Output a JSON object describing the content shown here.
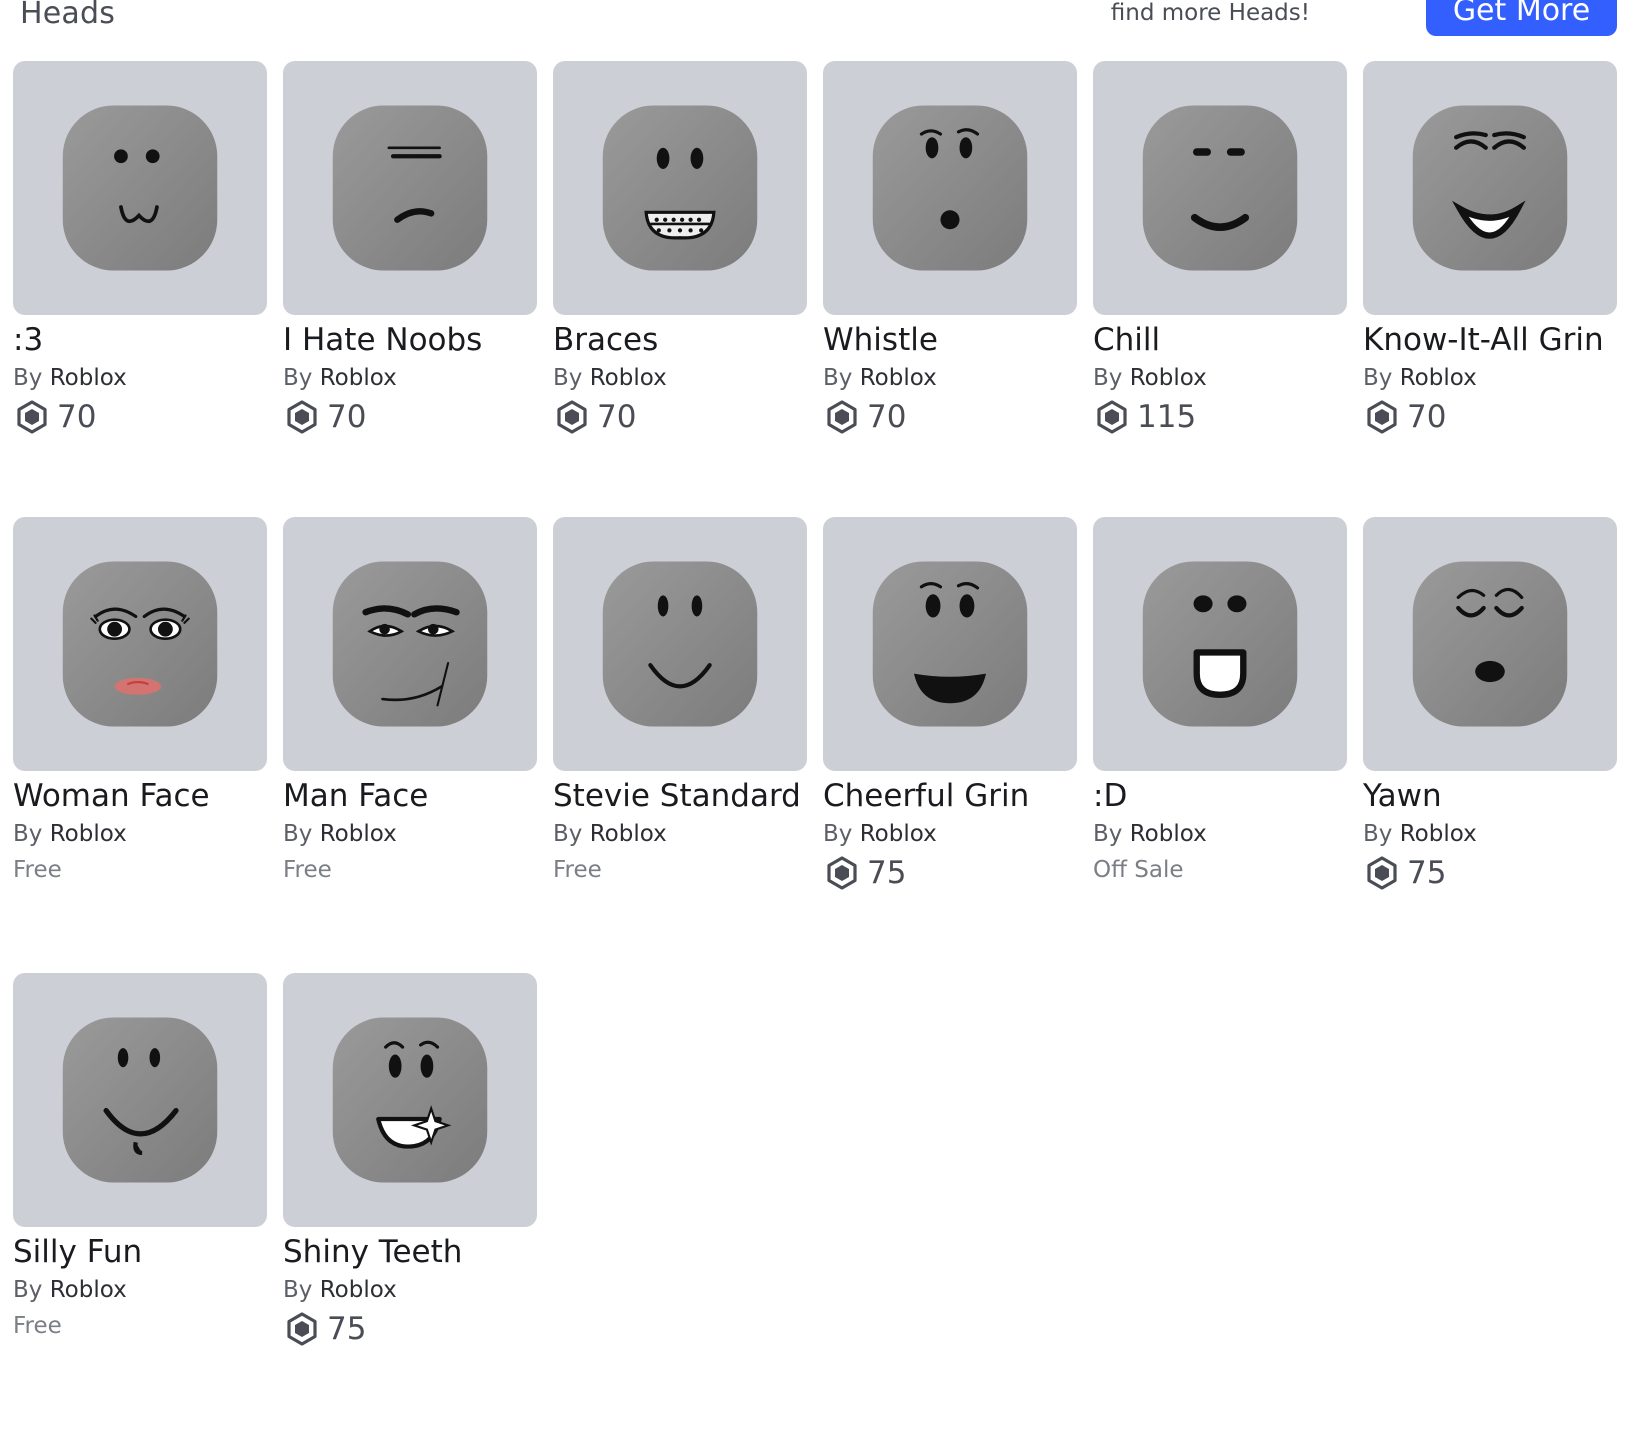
{
  "header": {
    "title": "Heads",
    "promo": "find more Heads!",
    "get_more_label": "Get More",
    "button_color": "#335fff"
  },
  "items": [
    {
      "name": ":3",
      "by": "By",
      "creator": "Roblox",
      "price": "70",
      "price_type": "robux",
      "face": "face-colon3-icon"
    },
    {
      "name": "I Hate Noobs",
      "by": "By",
      "creator": "Roblox",
      "price": "70",
      "price_type": "robux",
      "face": "face-i-hate-noobs-icon"
    },
    {
      "name": "Braces",
      "by": "By",
      "creator": "Roblox",
      "price": "70",
      "price_type": "robux",
      "face": "face-braces-icon"
    },
    {
      "name": "Whistle",
      "by": "By",
      "creator": "Roblox",
      "price": "70",
      "price_type": "robux",
      "face": "face-whistle-icon"
    },
    {
      "name": "Chill",
      "by": "By",
      "creator": "Roblox",
      "price": "115",
      "price_type": "robux",
      "face": "face-chill-icon"
    },
    {
      "name": "Know-It-All Grin",
      "by": "By",
      "creator": "Roblox",
      "price": "70",
      "price_type": "robux",
      "face": "face-know-it-all-grin-icon"
    },
    {
      "name": "Woman Face",
      "by": "By",
      "creator": "Roblox",
      "price": "Free",
      "price_type": "text",
      "face": "face-woman-icon"
    },
    {
      "name": "Man Face",
      "by": "By",
      "creator": "Roblox",
      "price": "Free",
      "price_type": "text",
      "face": "face-man-icon"
    },
    {
      "name": "Stevie Standard",
      "by": "By",
      "creator": "Roblox",
      "price": "Free",
      "price_type": "text",
      "face": "face-stevie-standard-icon"
    },
    {
      "name": "Cheerful Grin",
      "by": "By",
      "creator": "Roblox",
      "price": "75",
      "price_type": "robux",
      "face": "face-cheerful-grin-icon"
    },
    {
      "name": ":D",
      "by": "By",
      "creator": "Roblox",
      "price": "Off Sale",
      "price_type": "text",
      "face": "face-colon-d-icon"
    },
    {
      "name": "Yawn",
      "by": "By",
      "creator": "Roblox",
      "price": "75",
      "price_type": "robux",
      "face": "face-yawn-icon"
    },
    {
      "name": "Silly Fun",
      "by": "By",
      "creator": "Roblox",
      "price": "Free",
      "price_type": "text",
      "face": "face-silly-fun-icon"
    },
    {
      "name": "Shiny Teeth",
      "by": "By",
      "creator": "Roblox",
      "price": "75",
      "price_type": "robux",
      "face": "face-shiny-teeth-icon"
    }
  ]
}
